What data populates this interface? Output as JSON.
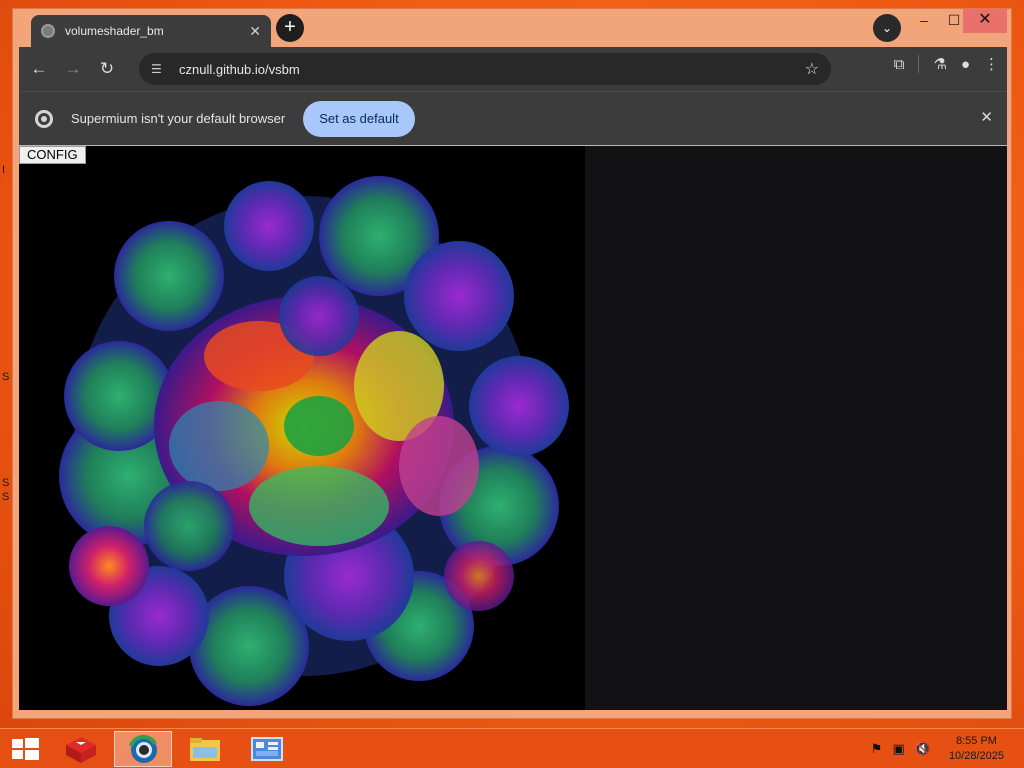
{
  "desktop": {
    "edge_glyphs": [
      "I",
      "S",
      "S",
      "S"
    ]
  },
  "browser": {
    "tab": {
      "title": "volumeshader_bm",
      "close_glyph": "✕"
    },
    "new_tab_glyph": "+",
    "tab_search_glyph": "⌄",
    "window_controls": {
      "minimize": "–",
      "maximize": "☐",
      "close": "✕"
    },
    "toolbar": {
      "back_glyph": "←",
      "forward_glyph": "→",
      "reload_glyph": "↻",
      "url": "cznull.github.io/vsbm",
      "site_info_glyph": "☰",
      "bookmark_glyph": "☆",
      "extensions_glyph": "⧉",
      "labs_glyph": "⚗",
      "profile_glyph": "●",
      "menu_glyph": "⋮"
    },
    "infobar": {
      "message": "Supermium isn't your default browser",
      "button_label": "Set as default",
      "close_glyph": "✕"
    }
  },
  "page": {
    "config_button_label": "CONFIG"
  },
  "taskbar": {
    "items": [
      "start",
      "app-red-box",
      "browser",
      "file-explorer",
      "control-panel"
    ],
    "tray_glyphs": {
      "flag": "⚑",
      "network": "▣",
      "volume": "🔇"
    },
    "time": "8:55 PM",
    "date": "10/28/2025"
  },
  "colors": {
    "desktop_orange": "#f05a14",
    "tab_bar": "#3c3c3c",
    "accent_button": "#a8c7fa",
    "close_red": "#e8716b"
  }
}
